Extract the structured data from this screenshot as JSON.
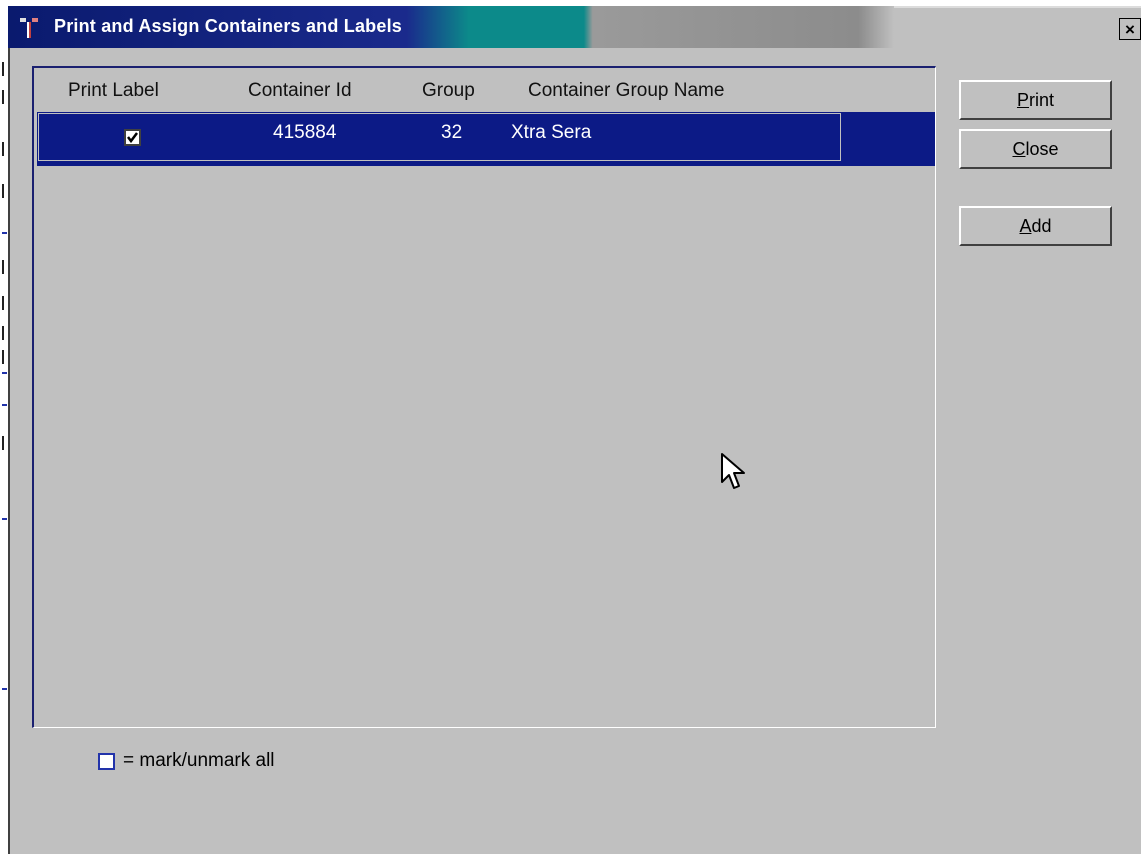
{
  "window": {
    "title": "Print and Assign Containers and Labels",
    "close_glyph": "×"
  },
  "table": {
    "columns": [
      "Print Label",
      "Container Id",
      "Group",
      "Container Group Name"
    ],
    "rows": [
      {
        "print_label": true,
        "container_id": "415884",
        "group": "32",
        "group_name": "Xtra Sera",
        "selected": true
      }
    ]
  },
  "buttons": {
    "print": {
      "mnemonic": "P",
      "rest": "rint"
    },
    "close": {
      "mnemonic": "C",
      "rest": "lose"
    },
    "add": {
      "mnemonic": "A",
      "rest": "dd"
    }
  },
  "mark_all": {
    "label": "= mark/unmark all",
    "checked": false
  },
  "colors": {
    "selection": "#0c1a86",
    "dialog_bg": "#c0c0c0"
  },
  "icons": [
    "app-icon",
    "close-icon",
    "checkbox-checked-icon",
    "mouse-cursor-icon"
  ]
}
